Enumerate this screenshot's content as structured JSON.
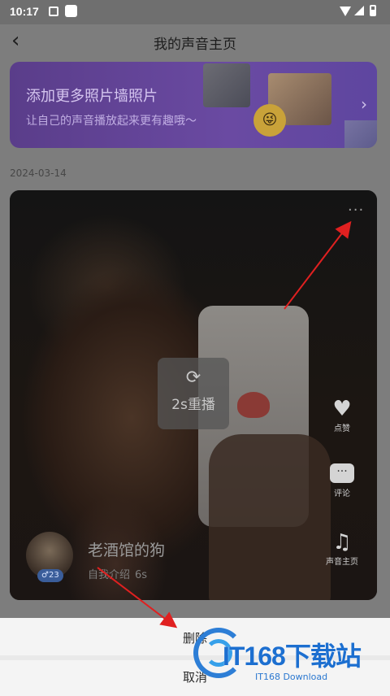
{
  "status_bar": {
    "time": "10:17"
  },
  "header": {
    "title": "我的声音主页"
  },
  "banner": {
    "title": "添加更多照片墙照片",
    "subtitle": "让自己的声音播放起来更有趣哦～"
  },
  "post": {
    "date": "2024-03-14",
    "replay_label": "2s重播",
    "username": "老酒馆的狗",
    "intro_label": "自我介绍",
    "duration": "6s",
    "avatar_badge": "23",
    "actions": {
      "like": "点赞",
      "comment": "评论",
      "voice_home": "声音主页"
    }
  },
  "sheet": {
    "delete_label": "删除",
    "cancel_label": "取消"
  },
  "watermark": {
    "brand": "IT168下载站",
    "sub": "IT168 Download"
  },
  "colors": {
    "arrow": "#e02020",
    "sheet_bg": "#f4f4f4",
    "brand_blue": "#1c6fd0"
  },
  "icons": [
    "back-icon",
    "more-icon",
    "replay-icon",
    "heart-icon",
    "comment-icon",
    "music-note-icon",
    "chevron-right-icon"
  ]
}
